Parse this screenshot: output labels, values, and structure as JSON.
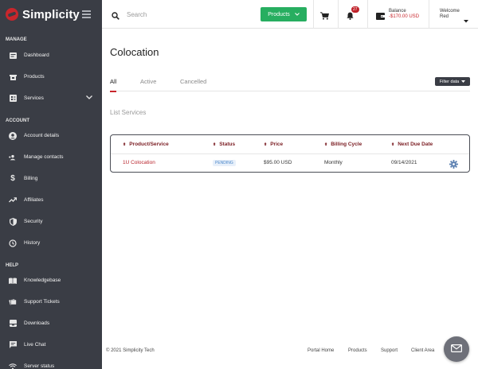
{
  "brand": {
    "name": "Simplicity"
  },
  "sidebar": {
    "sections": {
      "manage": "MANAGE",
      "account": "ACCOUNT",
      "help": "HELP"
    },
    "manage_items": [
      {
        "label": "Dashboard",
        "icon": "dashboard-icon"
      },
      {
        "label": "Products",
        "icon": "products-icon"
      },
      {
        "label": "Services",
        "icon": "services-icon"
      }
    ],
    "account_items": [
      {
        "label": "Account details",
        "icon": "account-icon"
      },
      {
        "label": "Manage contacts",
        "icon": "contacts-icon"
      },
      {
        "label": "Billing",
        "icon": "dollar-icon"
      },
      {
        "label": "Affiliates",
        "icon": "trend-icon"
      },
      {
        "label": "Security",
        "icon": "shield-icon"
      },
      {
        "label": "History",
        "icon": "history-icon"
      }
    ],
    "help_items": [
      {
        "label": "Knowledgebase",
        "icon": "book-icon"
      },
      {
        "label": "Support Tickets",
        "icon": "ticket-icon"
      },
      {
        "label": "Downloads",
        "icon": "download-icon"
      },
      {
        "label": "Live Chat",
        "icon": "chat-icon"
      },
      {
        "label": "Server status",
        "icon": "wifi-icon"
      }
    ]
  },
  "topbar": {
    "search_placeholder": "Search",
    "products_button": "Products",
    "notification_count": "27",
    "balance_label": "Balance",
    "balance_value": "-$170.00 USD",
    "welcome_label": "Welcome",
    "welcome_name": "Red"
  },
  "main": {
    "title": "Colocation",
    "tabs": [
      {
        "label": "All",
        "active": true
      },
      {
        "label": "Active",
        "active": false
      },
      {
        "label": "Cancelled",
        "active": false
      }
    ],
    "filter_button": "Filter data",
    "list_heading": "List Services",
    "table": {
      "headers": [
        "Product/Service",
        "Status",
        "Price",
        "Billing Cycle",
        "Next Due Date"
      ],
      "rows": [
        {
          "product": "1U Colocation",
          "status": "PENDING",
          "price": "$95.00 USD",
          "cycle": "Monthly",
          "due": "09/14/2021"
        }
      ]
    }
  },
  "footer": {
    "copyright": "© 2021 Simplicity Tech",
    "links": [
      "Portal Home",
      "Products",
      "Support",
      "Client Area"
    ]
  },
  "colors": {
    "sidebar_bg": "#3a3d45",
    "accent_red": "#c8262c",
    "green": "#27ae60",
    "status_blue": "#4a86c9"
  }
}
